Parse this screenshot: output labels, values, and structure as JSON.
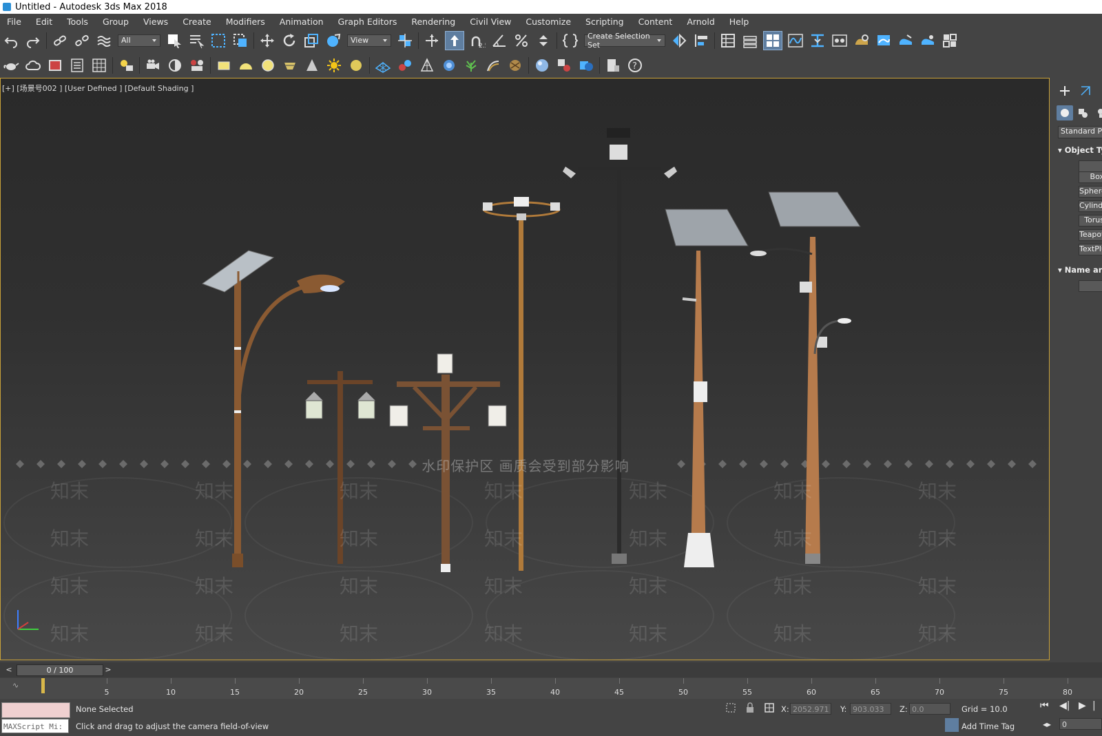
{
  "window": {
    "title": "Untitled - Autodesk 3ds Max 2018"
  },
  "menu": [
    "File",
    "Edit",
    "Tools",
    "Group",
    "Views",
    "Create",
    "Modifiers",
    "Animation",
    "Graph Editors",
    "Rendering",
    "Civil View",
    "Customize",
    "Scripting",
    "Content",
    "Arnold",
    "Help"
  ],
  "toolbar": {
    "selection_filter": "All",
    "reference_coord": "View",
    "snap_label": "2.5",
    "named_selection": "Create Selection Set"
  },
  "viewport": {
    "label": "[+] [场景号002 ] [User Defined ] [Default Shading ]",
    "watermark_banner": "水印保护区  画质会受到部分影响",
    "watermark_text": "知末"
  },
  "command_panel": {
    "category": "Standard Primitives",
    "rollout_object_type": "Object Type",
    "rollout_name_color": "Name and Color",
    "object_buttons": [
      "Box",
      "Sphere",
      "Cylinder",
      "Torus",
      "Teapot",
      "TextPlus"
    ]
  },
  "timeline": {
    "frame_display": "0 / 100",
    "prev": "<",
    "next": ">",
    "ticks": [
      "5",
      "10",
      "15",
      "20",
      "25",
      "30",
      "35",
      "40",
      "45",
      "50",
      "55",
      "60",
      "65",
      "70",
      "75",
      "80"
    ]
  },
  "status": {
    "maxscript": "MAXScript Mi:",
    "selection": "None Selected",
    "prompt": "Click and drag to adjust the camera field-of-view",
    "x_label": "X:",
    "x_value": "2052.971",
    "y_label": "Y:",
    "y_value": "903.033",
    "z_label": "Z:",
    "z_value": "0.0",
    "grid": "Grid = 10.0",
    "add_time_tag": "Add Time Tag",
    "frame_field": "0"
  }
}
